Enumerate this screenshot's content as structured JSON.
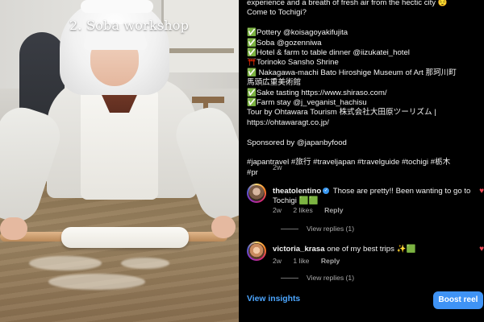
{
  "video": {
    "overlay_title": "2. Soba workshop"
  },
  "caption": {
    "lines": [
      "experience and a breath of fresh air from the hectic city 😌",
      "Come to Tochigi?",
      "",
      "✅Pottery @koisagoyakifujita",
      "✅Soba @gozenniwa",
      "✅Hotel & farm to table dinner @iizukatei_hotel",
      "⛩️Torinoko Sansho Shrine",
      "✅ Nakagawa-machi Bato Hiroshige Museum of Art 那珂川町",
      "馬頭広重美術館",
      "✅Sake tasting https://www.shiraso.com/",
      "✅Farm stay @j_veganist_hachisu",
      "Tour by Ohtawara Tourism 株式会社大田原ツーリズム |",
      "https://ohtawaragt.co.jp/",
      "",
      "Sponsored by @japanbyfood",
      "",
      "#japantravel #旅行 #traveljapan #travelguide #tochigi #栃木",
      "#pr"
    ],
    "age": "2w"
  },
  "comments": [
    {
      "username": "theatolentino",
      "verified": true,
      "text": "Those are pretty!! Been wanting to go to Tochigi 🟩🟩",
      "age": "2w",
      "likes": "2 likes",
      "reply_label": "Reply",
      "view_replies": "View replies (1)"
    },
    {
      "username": "victoria_krasa",
      "verified": false,
      "text": "one of my best trips ✨🟩",
      "age": "2w",
      "likes": "1 like",
      "reply_label": "Reply",
      "view_replies": "View replies (1)"
    }
  ],
  "footer": {
    "view_insights": "View insights",
    "boost_reel": "Boost reel"
  },
  "icons": {
    "like": "heart-icon",
    "verified": "verified-badge-icon"
  },
  "colors": {
    "background": "#000000",
    "link_blue": "#4ca6ff",
    "button_blue": "#3f93f5",
    "muted_text": "#a8a8a8",
    "like_red": "#ed4956"
  }
}
